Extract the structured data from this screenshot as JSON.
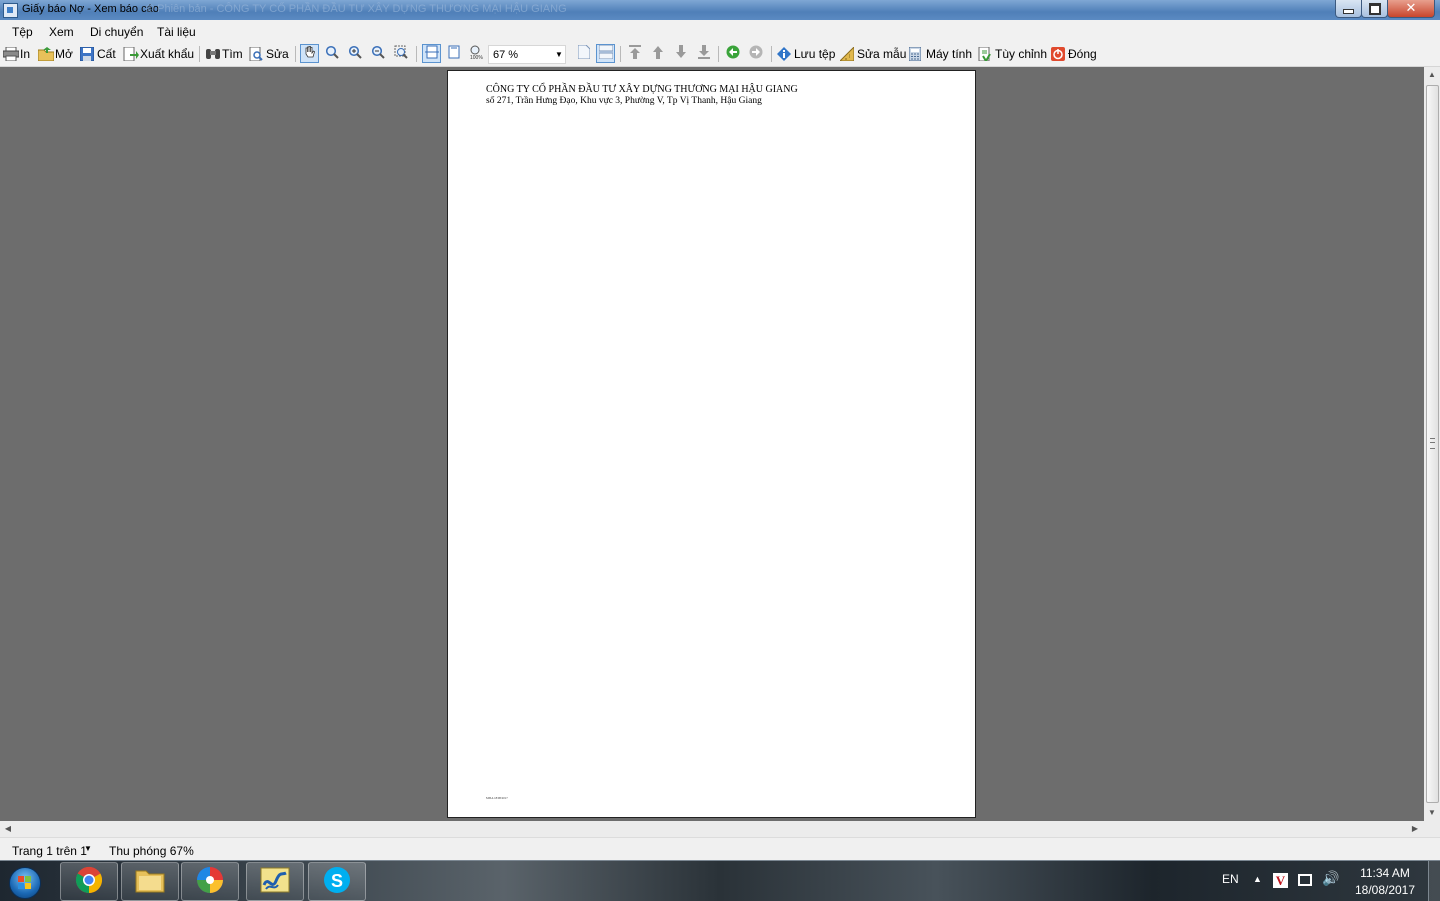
{
  "window": {
    "title": "Giấy báo Nợ - Xem báo cáo",
    "title_ghost": "© Phiên bản - CÔNG TY CỔ PHẦN ĐẦU TƯ XÂY DỰNG THƯƠNG MẠI HẬU GIANG"
  },
  "menu": {
    "items": [
      "Tệp",
      "Xem",
      "Di chuyển",
      "Tài liệu"
    ]
  },
  "toolbar": {
    "print": "In",
    "open": "Mở",
    "save": "Cất",
    "export": "Xuất khẩu",
    "find": "Tìm",
    "edit": "Sửa",
    "zoom_value": "67 %",
    "save_file": "Lưu tệp",
    "edit_template": "Sửa mẫu",
    "calculator": "Máy tính",
    "customize": "Tùy chỉnh",
    "close": "Đóng"
  },
  "document": {
    "company_name": "CÔNG TY CỔ PHẦN ĐẦU TƯ XÂY DỰNG THƯƠNG MẠI HẬU GIANG",
    "address": "số 271, Trần Hưng Đạo, Khu vực 3, Phường V, Tp Vị Thanh, Hậu Giang",
    "footer": "MISA 18/08/2017"
  },
  "status": {
    "page": "Trang 1 trên 1",
    "zoom": "Thu phóng 67%"
  },
  "taskbar": {
    "apps": [
      "chrome-icon",
      "file-explorer-icon",
      "picasa-icon",
      "misa-icon",
      "skype-icon"
    ],
    "language": "EN",
    "time": "11:34 AM",
    "date": "18/08/2017"
  },
  "colors": {
    "workspace": "#6d6d6d",
    "titlebar": "#5b8ac2",
    "toolbar": "#f1f1f1"
  }
}
